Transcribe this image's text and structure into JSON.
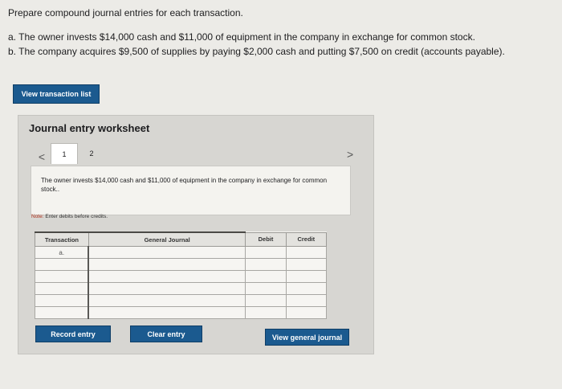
{
  "instructions": {
    "title": "Prepare compound journal entries for each transaction.",
    "items": [
      "a. The owner invests $14,000 cash and $11,000 of equipment in the company in exchange for common stock.",
      "b. The company acquires $9,500 of supplies by paying $2,000 cash and putting $7,500 on credit (accounts payable)."
    ]
  },
  "view_transactions_label": "View transaction list",
  "worksheet": {
    "title": "Journal entry worksheet",
    "tabs": [
      "1",
      "2"
    ],
    "prev_glyph": "<",
    "next_glyph": ">",
    "description": "The owner invests $14,000 cash and $11,000 of equipment in the company in exchange for common stock..",
    "note_prefix": "Note:",
    "note_text": " Enter debits before credits.",
    "table": {
      "headers": [
        "Transaction",
        "General Journal",
        "Debit",
        "Credit"
      ],
      "rows": [
        {
          "transaction": "a."
        },
        {
          "transaction": ""
        },
        {
          "transaction": ""
        },
        {
          "transaction": ""
        },
        {
          "transaction": ""
        },
        {
          "transaction": ""
        }
      ]
    },
    "record_label": "Record entry",
    "clear_label": "Clear entry"
  },
  "view_general_journal_label": "View general journal"
}
